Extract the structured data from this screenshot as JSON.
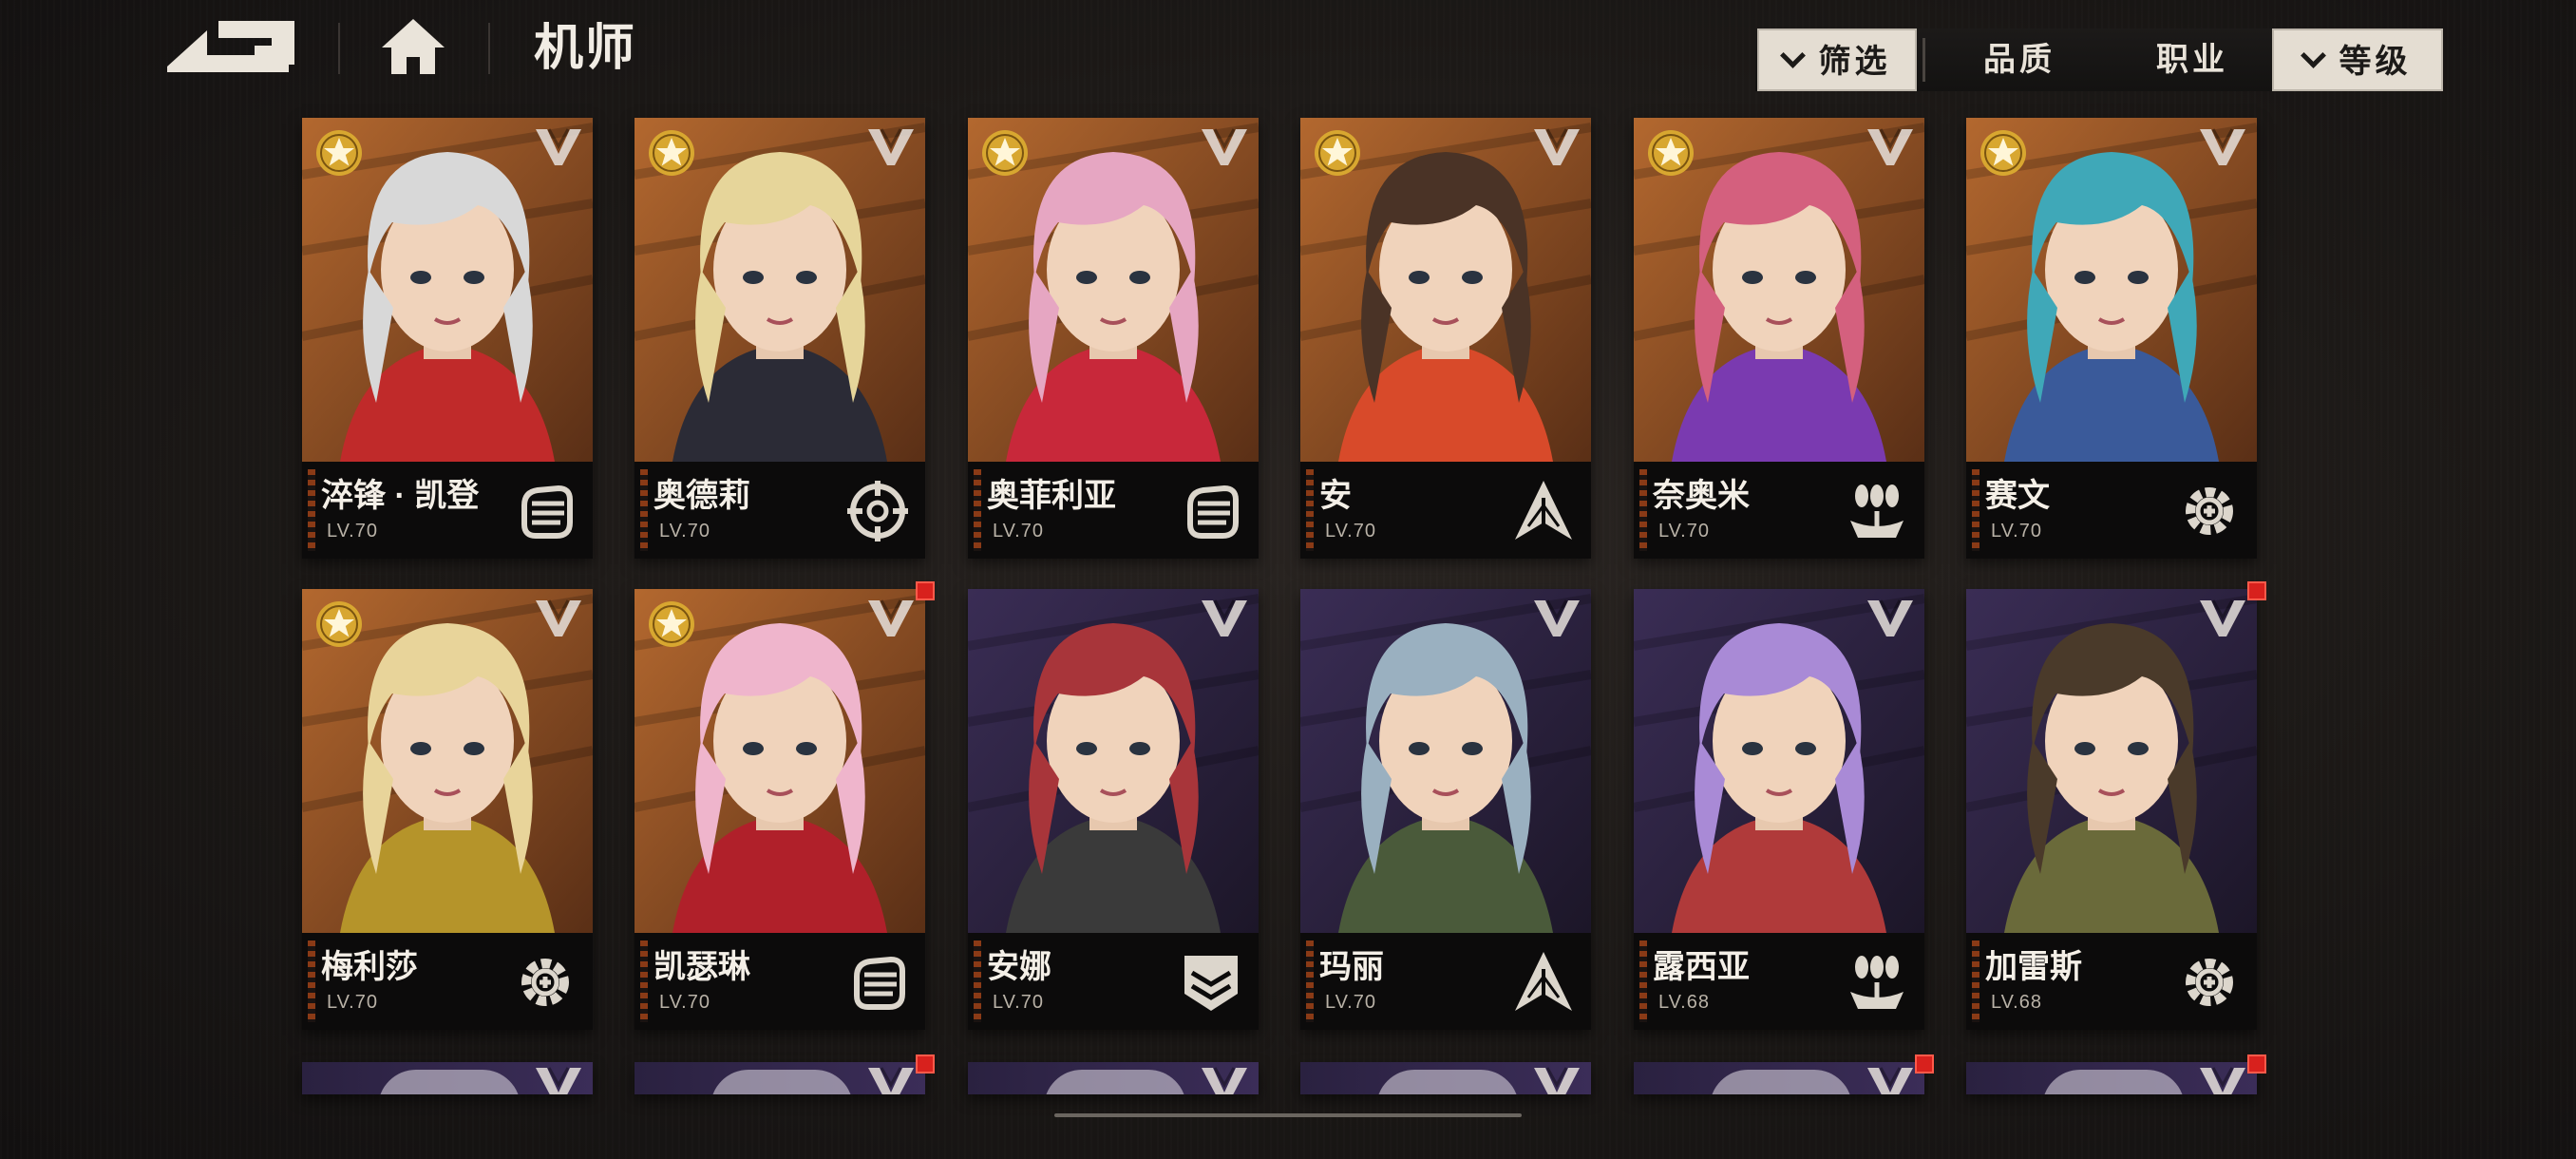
{
  "header": {
    "title": "机师"
  },
  "filters": {
    "filter_label": "筛选",
    "quality_label": "品质",
    "job_label": "职业",
    "level_label": "等级"
  },
  "characters": [
    {
      "name": "淬锋 · 凯登",
      "level": "LV.70",
      "class_icon": "fist-icon",
      "bg": "orange",
      "hair": "#d8d8d8",
      "accent": "#c02a2a"
    },
    {
      "name": "奥德莉",
      "level": "LV.70",
      "class_icon": "crosshair-icon",
      "bg": "orange",
      "hair": "#e6d59a",
      "accent": "#2b2b36"
    },
    {
      "name": "奥菲利亚",
      "level": "LV.70",
      "class_icon": "fist-icon",
      "bg": "orange",
      "hair": "#e6a6c2",
      "accent": "#c8283a"
    },
    {
      "name": "安",
      "level": "LV.70",
      "class_icon": "spike-icon",
      "bg": "orange",
      "hair": "#4a3326",
      "accent": "#d84a2a"
    },
    {
      "name": "奈奥米",
      "level": "LV.70",
      "class_icon": "bombs-icon",
      "bg": "orange",
      "hair": "#d4607e",
      "accent": "#7a3ab0"
    },
    {
      "name": "赛文",
      "level": "LV.70",
      "class_icon": "wrench-gear-icon",
      "bg": "orange",
      "hair": "#3fa8b8",
      "accent": "#3a5a9a"
    },
    {
      "name": "梅利莎",
      "level": "LV.70",
      "class_icon": "wrench-gear-icon",
      "bg": "orange",
      "hair": "#e8d49a",
      "accent": "#b5942a"
    },
    {
      "name": "凯瑟琳",
      "level": "LV.70",
      "class_icon": "fist-icon",
      "bg": "orange",
      "hair": "#efb5cc",
      "accent": "#b0202a"
    },
    {
      "name": "安娜",
      "level": "LV.70",
      "class_icon": "chevron-shield-icon",
      "bg": "purple",
      "hair": "#a8353a",
      "accent": "#3a3a3a"
    },
    {
      "name": "玛丽",
      "level": "LV.70",
      "class_icon": "spike-icon",
      "bg": "purple",
      "hair": "#9ab0c0",
      "accent": "#4a5a3a"
    },
    {
      "name": "露西亚",
      "level": "LV.68",
      "class_icon": "bombs-icon",
      "bg": "purple",
      "hair": "#a98ad6",
      "accent": "#b03a3a"
    },
    {
      "name": "加雷斯",
      "level": "LV.68",
      "class_icon": "wrench-gear-icon",
      "bg": "purple",
      "hair": "#4a3a2a",
      "accent": "#6a6a3a"
    }
  ]
}
